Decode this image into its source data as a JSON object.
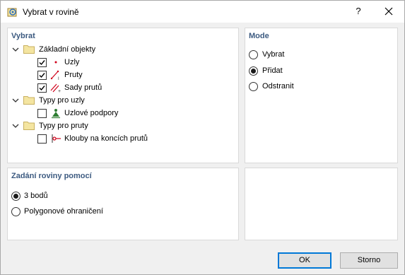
{
  "window": {
    "title": "Vybrat v rovině",
    "help_label": "?"
  },
  "select_panel": {
    "title": "Vybrat",
    "tree": {
      "basic_objects": {
        "label": "Základní objekty",
        "expanded": true
      },
      "nodes": {
        "label": "Uzly",
        "checked": true
      },
      "members": {
        "label": "Pruty",
        "checked": true
      },
      "member_sets": {
        "label": "Sady prutů",
        "checked": true
      },
      "node_types": {
        "label": "Typy pro uzly",
        "expanded": true
      },
      "nodal_supports": {
        "label": "Uzlové podpory",
        "checked": false
      },
      "member_types": {
        "label": "Typy pro pruty",
        "expanded": true
      },
      "member_hinges": {
        "label": "Klouby na koncích prutů",
        "checked": false
      }
    }
  },
  "mode_panel": {
    "title": "Mode",
    "options": [
      {
        "label": "Vybrat",
        "selected": false
      },
      {
        "label": "Přidat",
        "selected": true
      },
      {
        "label": "Odstranit",
        "selected": false
      }
    ]
  },
  "plane_panel": {
    "title": "Zadání roviny pomocí",
    "options": [
      {
        "label": "3 bodů",
        "selected": true
      },
      {
        "label": "Polygonové ohraničení",
        "selected": false
      }
    ]
  },
  "buttons": {
    "ok": "OK",
    "cancel": "Storno"
  },
  "colors": {
    "panel_title": "#3c5a80",
    "folder": "#f4e5a1",
    "accent": "#0078d7"
  }
}
